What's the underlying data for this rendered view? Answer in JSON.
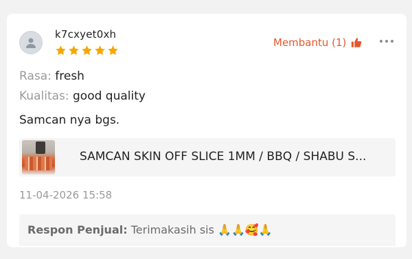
{
  "review": {
    "username": "k7cxyet0xh",
    "rating": 5,
    "helpful_label": "Membantu (1)",
    "attributes": [
      {
        "label": "Rasa:",
        "value": "fresh"
      },
      {
        "label": "Kualitas:",
        "value": "good quality"
      }
    ],
    "text": "Samcan nya bgs.",
    "product_name": "SAMCAN SKIN OFF SLICE 1MM / BBQ / SHABU S...",
    "timestamp": "11-04-2026 15:58",
    "seller_reply": {
      "label": "Respon Penjual:",
      "text": "Terimakasih sis 🙏🙏🥰🙏"
    }
  },
  "icons": {
    "avatar": "user-avatar-icon",
    "star": "star-icon",
    "helpful": "thumbs-up-icon",
    "more": "more-horizontal-icon"
  },
  "colors": {
    "accent": "#e4572e",
    "star": "#f6a700",
    "muted": "#9a9a9a",
    "panel": "#f5f5f5"
  }
}
